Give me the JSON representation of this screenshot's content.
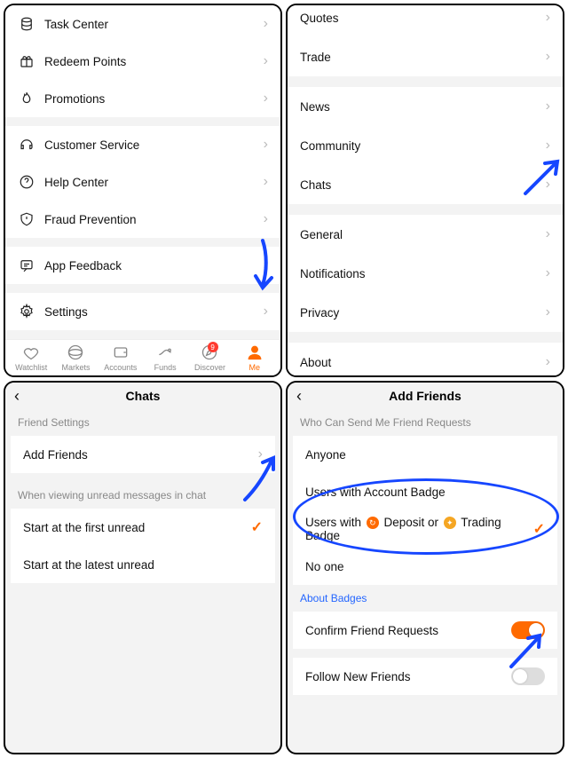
{
  "panel1": {
    "rows": [
      {
        "label": "Task Center"
      },
      {
        "label": "Redeem Points"
      },
      {
        "label": "Promotions"
      }
    ],
    "rows2": [
      {
        "label": "Customer Service"
      },
      {
        "label": "Help Center"
      },
      {
        "label": "Fraud Prevention"
      }
    ],
    "feedback_label": "App Feedback",
    "settings_label": "Settings",
    "tabs": [
      {
        "label": "Watchlist"
      },
      {
        "label": "Markets"
      },
      {
        "label": "Accounts"
      },
      {
        "label": "Funds"
      },
      {
        "label": "Discover",
        "badge": "9"
      },
      {
        "label": "Me",
        "active": true
      }
    ]
  },
  "panel2": {
    "groups": [
      [
        "Quotes",
        "Trade"
      ],
      [
        "News",
        "Community",
        "Chats"
      ],
      [
        "General",
        "Notifications",
        "Privacy"
      ],
      [
        "About"
      ]
    ]
  },
  "panel3": {
    "title": "Chats",
    "section1_header": "Friend Settings",
    "add_friends": "Add Friends",
    "section2_header": "When viewing unread messages in chat",
    "opt1": "Start at the first unread",
    "opt2": "Start at the latest unread"
  },
  "panel4": {
    "title": "Add Friends",
    "who_header": "Who Can Send Me Friend Requests",
    "opts": [
      "Anyone",
      "Users with Account Badge",
      "Users with Deposit or Trading Badge",
      "No one"
    ],
    "about_badges": "About Badges",
    "confirm": "Confirm Friend Requests",
    "follow": "Follow New Friends"
  }
}
